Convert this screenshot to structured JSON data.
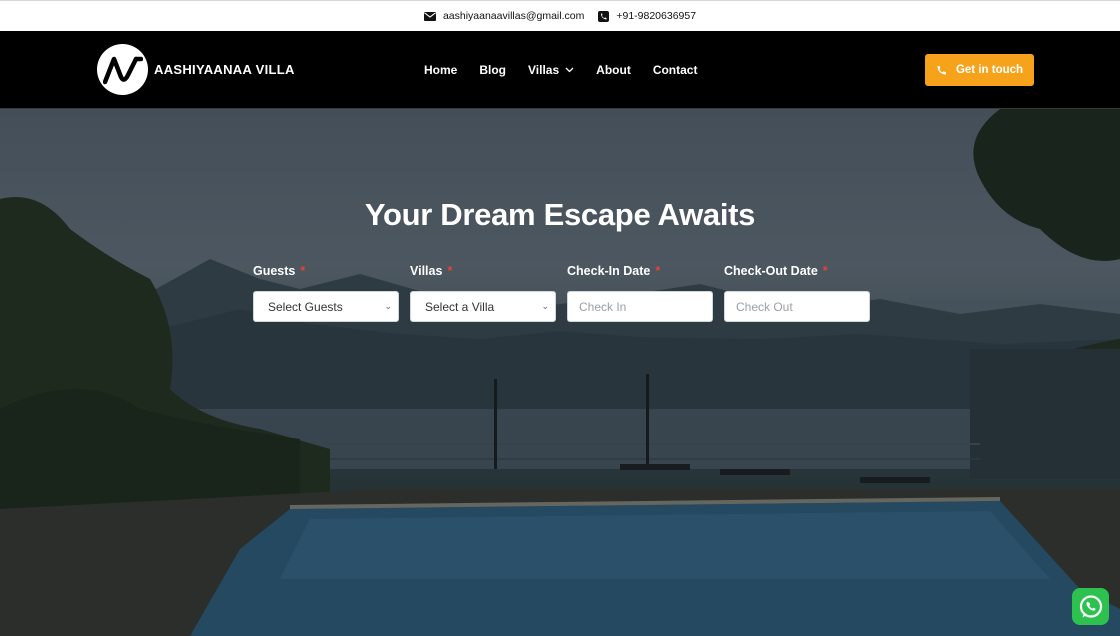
{
  "topbar": {
    "email": "aashiyaanaavillas@gmail.com",
    "phone": "+91-9820636957",
    "email_icon": "envelope-icon",
    "phone_icon": "phone-icon"
  },
  "header": {
    "logo_text": "AASHIYAANAA VILLA",
    "nav": {
      "home": "Home",
      "blog": "Blog",
      "villas": "Villas",
      "about": "About",
      "contact": "Contact"
    },
    "cta_label": "Get in touch"
  },
  "hero": {
    "title": "Your Dream Escape Awaits"
  },
  "form": {
    "guests": {
      "label": "Guests",
      "required": "*",
      "value": "Select Guests"
    },
    "villas": {
      "label": "Villas",
      "required": "*",
      "value": "Select a Villa"
    },
    "checkin": {
      "label": "Check-In Date",
      "required": "*",
      "placeholder": "Check In"
    },
    "checkout": {
      "label": "Check-Out Date",
      "required": "*",
      "placeholder": "Check Out"
    }
  },
  "colors": {
    "accent": "#f6a21a",
    "header_bg": "#000000",
    "required": "#e8413a",
    "whatsapp": "#2dc24f"
  }
}
